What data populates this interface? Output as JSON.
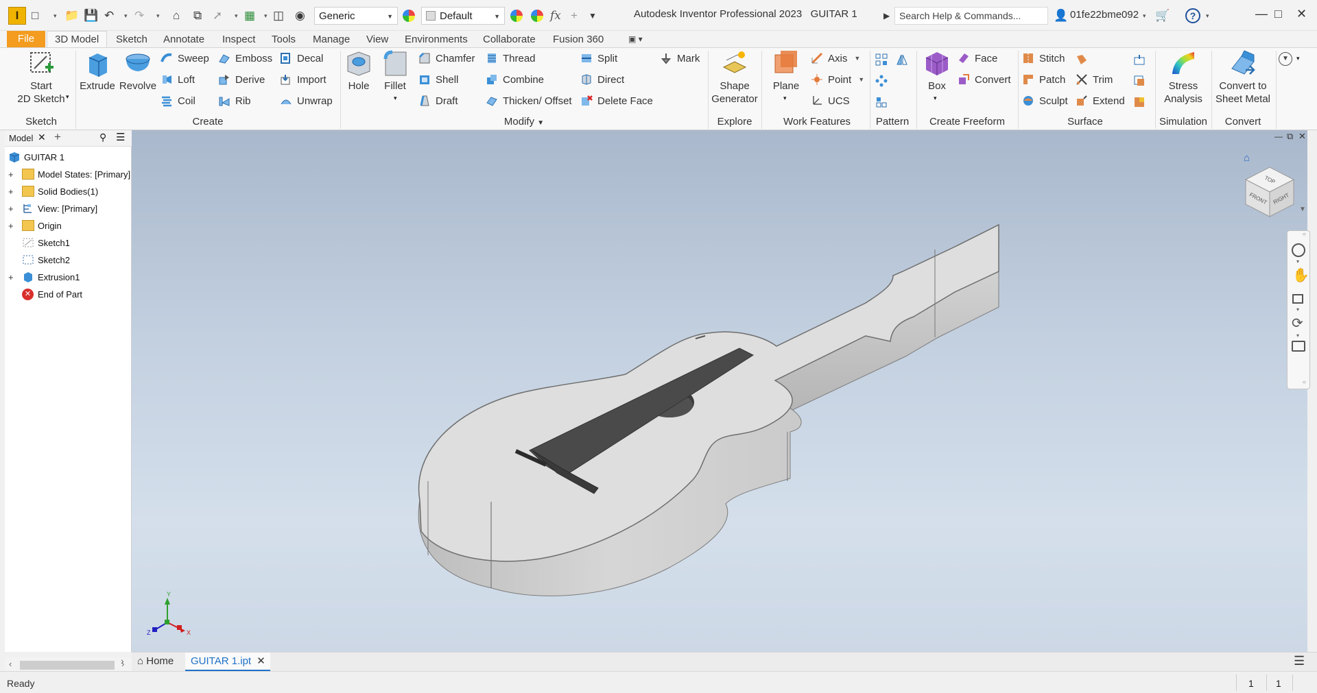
{
  "titlebar": {
    "app_title": "Autodesk Inventor Professional 2023",
    "doc_title": "GUITAR 1",
    "material": "Generic",
    "appearance": "Default",
    "search_placeholder": "Search Help & Commands...",
    "user": "01fe22bme092"
  },
  "menu": {
    "file": "File",
    "tabs": [
      "3D Model",
      "Sketch",
      "Annotate",
      "Inspect",
      "Tools",
      "Manage",
      "View",
      "Environments",
      "Collaborate",
      "Fusion 360"
    ]
  },
  "ribbon": {
    "sketch": {
      "title": "Sketch",
      "start_line1": "Start",
      "start_line2": "2D Sketch"
    },
    "create": {
      "title": "Create",
      "extrude": "Extrude",
      "revolve": "Revolve",
      "sweep": "Sweep",
      "loft": "Loft",
      "coil": "Coil",
      "emboss": "Emboss",
      "derive": "Derive",
      "rib": "Rib",
      "decal": "Decal",
      "import": "Import",
      "unwrap": "Unwrap"
    },
    "modify": {
      "title": "Modify",
      "hole": "Hole",
      "fillet": "Fillet",
      "chamfer": "Chamfer",
      "shell": "Shell",
      "draft": "Draft",
      "thread": "Thread",
      "combine": "Combine",
      "thicken": "Thicken/ Offset",
      "split": "Split",
      "direct": "Direct",
      "delete_face": "Delete Face",
      "mark": "Mark"
    },
    "explore": {
      "title": "Explore",
      "shape_line1": "Shape",
      "shape_line2": "Generator"
    },
    "work": {
      "title": "Work Features",
      "plane": "Plane",
      "axis": "Axis",
      "point": "Point",
      "ucs": "UCS"
    },
    "pattern": {
      "title": "Pattern"
    },
    "freeform": {
      "title": "Create Freeform",
      "box": "Box",
      "face": "Face",
      "convert": "Convert"
    },
    "surface": {
      "title": "Surface",
      "stitch": "Stitch",
      "patch": "Patch",
      "sculpt": "Sculpt",
      "trim": "Trim",
      "extend": "Extend"
    },
    "simulation": {
      "title": "Simulation",
      "stress_line1": "Stress",
      "stress_line2": "Analysis"
    },
    "convert": {
      "title": "Convert",
      "line1": "Convert to",
      "line2": "Sheet Metal"
    }
  },
  "browser": {
    "tab": "Model",
    "nodes": [
      "GUITAR 1",
      "Model States: [Primary]",
      "Solid Bodies(1)",
      "View: [Primary]",
      "Origin",
      "Sketch1",
      "Sketch2",
      "Extrusion1",
      "End of Part"
    ]
  },
  "viewcube": {
    "top": "TOP",
    "front": "FRONT",
    "right": "RIGHT"
  },
  "triad": {
    "x": "X",
    "y": "Y",
    "z": "Z"
  },
  "docbar": {
    "home": "Home",
    "doc": "GUITAR 1.ipt"
  },
  "status": {
    "text": "Ready",
    "count1": "1",
    "count2": "1"
  },
  "colors": {
    "file_tab": "#f39c1f",
    "accent": "#1e70c8",
    "background_top": "#a9b8cc",
    "background_bottom": "#d4dfeb"
  }
}
